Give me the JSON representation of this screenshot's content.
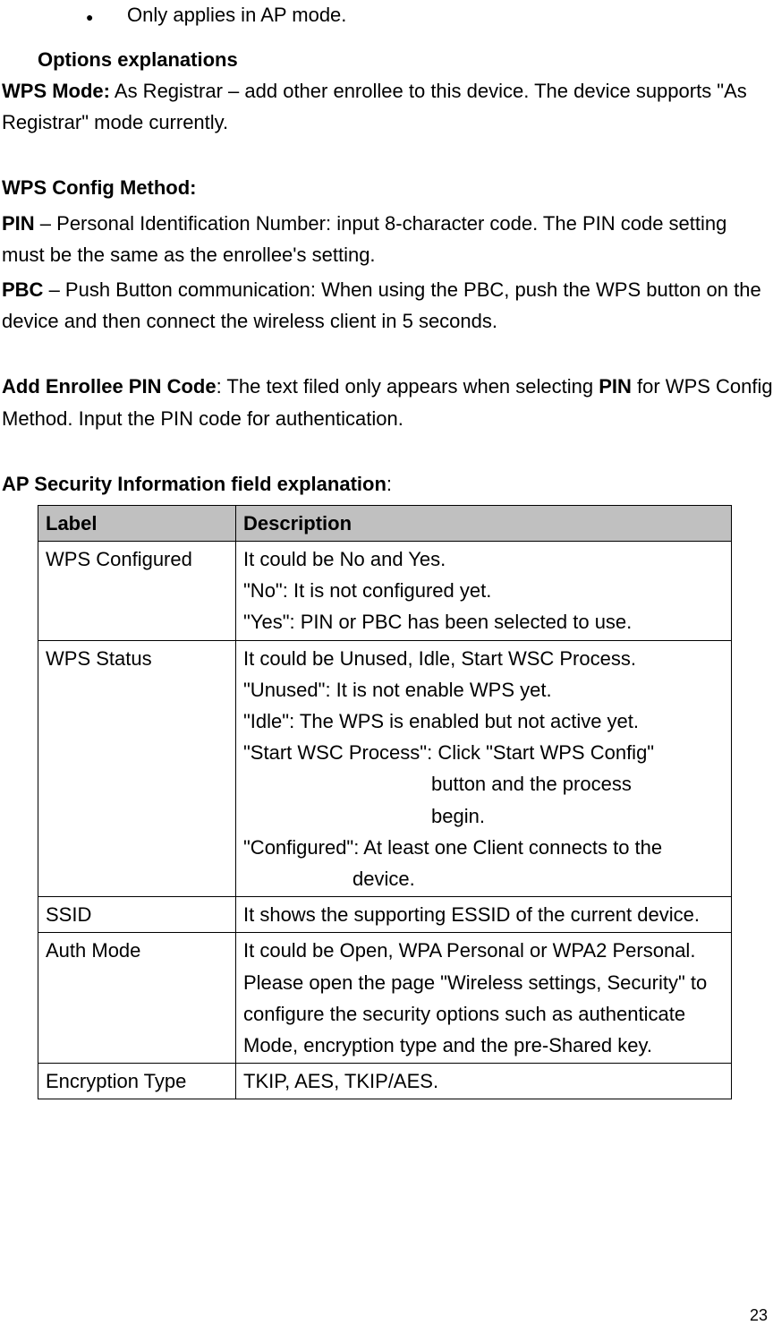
{
  "bullet": {
    "item": "Only applies in AP mode."
  },
  "headings": {
    "options": "Options explanations",
    "wps_mode_label": "WPS Mode:",
    "wps_config_label": "WPS Config Method:",
    "add_enrollee_label": "Add Enrollee PIN Code",
    "ap_sec_label": "AP Security Information field explanation"
  },
  "wps_mode_text": " As Registrar – add other enrollee to this device. The device supports \"As Registrar\" mode currently.",
  "pin": {
    "label": "PIN",
    "text": " – Personal Identification Number: input 8-character code. The PIN code setting must be the same as the enrollee's setting."
  },
  "pbc": {
    "label": "PBC",
    "text": " – Push Button communication: When using the PBC, push the WPS button on the device and then connect the wireless client in 5 seconds."
  },
  "add_enrollee": {
    "text1": ": The text filed only appears when selecting ",
    "bold_pin": "PIN",
    "text2": " for WPS Config Method. Input the PIN code for authentication."
  },
  "table": {
    "header": {
      "label": "Label",
      "desc": "Description"
    },
    "rows": [
      {
        "label": "WPS Configured",
        "desc_lines": [
          "It could be No and Yes.",
          "\"No\": It is not configured yet.",
          "\"Yes\": PIN or PBC has been selected to use."
        ]
      },
      {
        "label": "WPS Status",
        "desc_lines": [
          "It could be Unused, Idle, Start WSC Process.",
          "\"Unused\": It is not enable WPS yet.",
          "\"Idle\": The WPS is enabled but not active yet.",
          "\"Start WSC Process\": Click \"Start WPS Config\""
        ],
        "hang1": [
          "button and the process",
          "begin."
        ],
        "configured_line": "\"Configured\": At least one Client connects to the",
        "hang2": [
          "device."
        ]
      },
      {
        "label": "SSID",
        "desc_lines": [
          "It shows the supporting ESSID of the current device."
        ]
      },
      {
        "label": "Auth Mode",
        "desc_lines": [
          "It could be Open, WPA Personal or WPA2 Personal. Please open the page \"Wireless settings, Security\" to configure the security options such as authenticate Mode, encryption type and the pre-Shared key."
        ]
      },
      {
        "label": "Encryption Type",
        "desc_lines": [
          "TKIP, AES, TKIP/AES."
        ]
      }
    ]
  },
  "page_number": "23"
}
